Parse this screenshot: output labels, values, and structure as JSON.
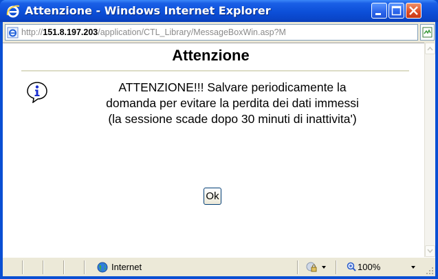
{
  "window": {
    "title": "Attenzione - Windows Internet Explorer",
    "title_icon": "ie-logo-icon",
    "controls": [
      "minimize",
      "maximize",
      "close"
    ]
  },
  "address": {
    "prefix": "http://",
    "host": "151.8.197.203",
    "path": "/application/CTL_Library/MessageBoxWin.asp?M",
    "icon": "ie-page-icon"
  },
  "dialog": {
    "heading": "Attenzione",
    "icon": "info-icon",
    "message_lines": [
      "ATTENZIONE!!! Salvare periodicamente la",
      "domanda per evitare la perdita dei dati immessi",
      "(la sessione scade dopo 30 minuti di inattivita')"
    ],
    "ok_label": "Ok"
  },
  "statusbar": {
    "zone_label": "Internet",
    "zoom_label": "100%"
  },
  "colors": {
    "titlebar": "#0a4fd3",
    "close_button": "#dd4a22",
    "chrome": "#ece9d8"
  }
}
